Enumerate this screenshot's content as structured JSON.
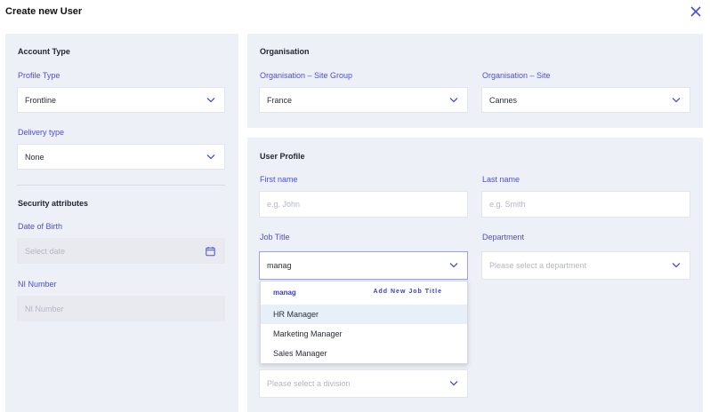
{
  "dialog": {
    "title": "Create new User",
    "close_icon": "close-icon"
  },
  "account": {
    "title": "Account Type",
    "profile_type_label": "Profile Type",
    "profile_type_value": "Frontline",
    "delivery_type_label": "Delivery type",
    "delivery_type_value": "None"
  },
  "security": {
    "title": "Security attributes",
    "dob_label": "Date of Birth",
    "dob_placeholder": "Select date",
    "ni_label": "NI Number",
    "ni_placeholder": "NI Number"
  },
  "organisation": {
    "title": "Organisation",
    "site_group_label": "Organisation – Site Group",
    "site_group_value": "France",
    "site_label": "Organisation – Site",
    "site_value": "Cannes"
  },
  "user_profile": {
    "title": "User Profile",
    "first_name_label": "First name",
    "first_name_placeholder": "e.g. John",
    "last_name_label": "Last name",
    "last_name_placeholder": "e.g. Smith",
    "job_title_label": "Job Title",
    "job_title_value": "manag",
    "department_label": "Department",
    "department_placeholder": "Please select a department",
    "division_placeholder": "Please select a division"
  },
  "job_dropdown": {
    "query": "manag",
    "add_new_label": "Add New Job Title",
    "options": [
      "HR Manager",
      "Marketing Manager",
      "Sales Manager"
    ],
    "highlighted_index": 0
  },
  "colors": {
    "accent": "#4a4fd6",
    "panel_bg": "#eef0f7",
    "highlight": "#e7f0f8"
  }
}
